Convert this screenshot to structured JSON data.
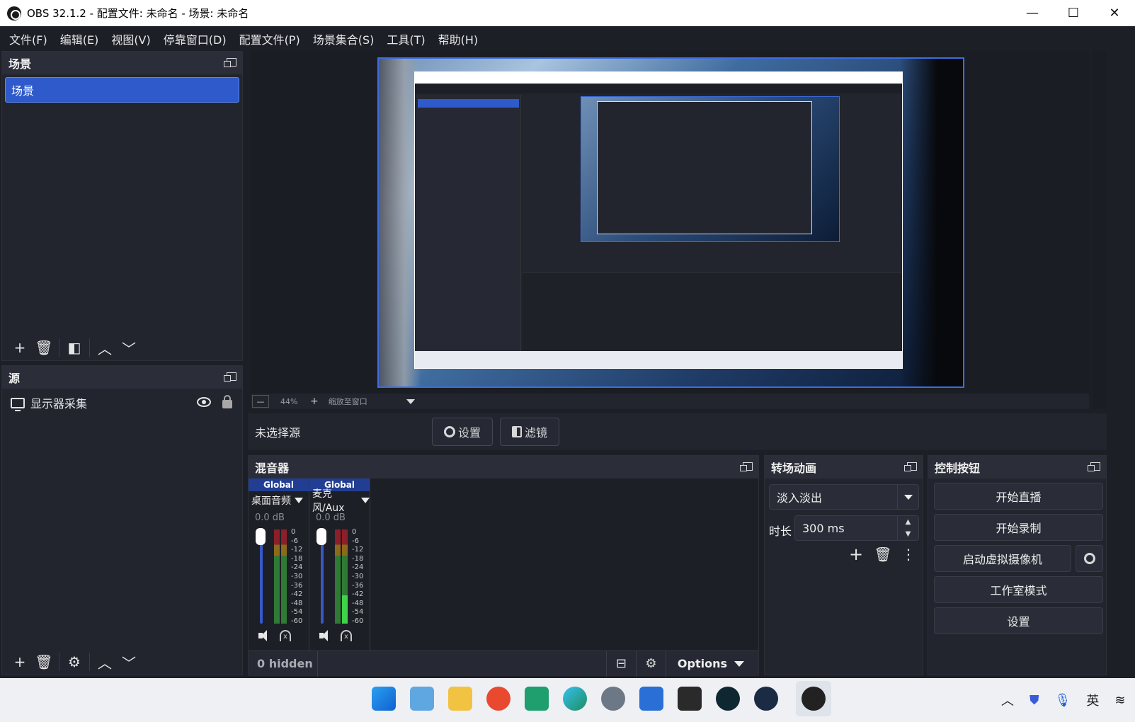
{
  "window": {
    "title": "OBS 32.1.2 - 配置文件: 未命名 - 场景: 未命名",
    "minimize": "—",
    "maximize": "☐",
    "close": "✕"
  },
  "menu": [
    "文件(F)",
    "编辑(E)",
    "视图(V)",
    "停靠窗口(D)",
    "配置文件(P)",
    "场景集合(S)",
    "工具(T)",
    "帮助(H)"
  ],
  "scenes": {
    "title": "场景",
    "items": [
      "场景"
    ]
  },
  "sources": {
    "title": "源",
    "items": [
      {
        "name": "显示器采集",
        "visible": true,
        "locked": true
      }
    ]
  },
  "preview": {
    "zoom": "44%",
    "scale_mode": "缩放至窗口"
  },
  "context": {
    "no_source": "未选择源",
    "settings": "设置",
    "filters": "滤镜"
  },
  "mixer": {
    "title": "混音器",
    "channels": [
      {
        "tag": "Global",
        "name": "桌面音频",
        "db": "0.0 dB"
      },
      {
        "tag": "Global",
        "name": "麦克风/Aux",
        "db": "0.0 dB"
      }
    ],
    "scale": [
      "0",
      "-6",
      "-12",
      "-18",
      "-24",
      "-30",
      "-36",
      "-42",
      "-48",
      "-54",
      "-60"
    ],
    "hidden": "0 hidden",
    "options": "Options"
  },
  "transitions": {
    "title": "转场动画",
    "selected": "淡入淡出",
    "duration_label": "时长",
    "duration": "300 ms"
  },
  "controls": {
    "title": "控制按钮",
    "start_stream": "开始直播",
    "start_record": "开始录制",
    "virtual_cam": "启动虚拟摄像机",
    "studio_mode": "工作室模式",
    "settings": "设置"
  },
  "taskbar": {
    "ime": "英"
  }
}
